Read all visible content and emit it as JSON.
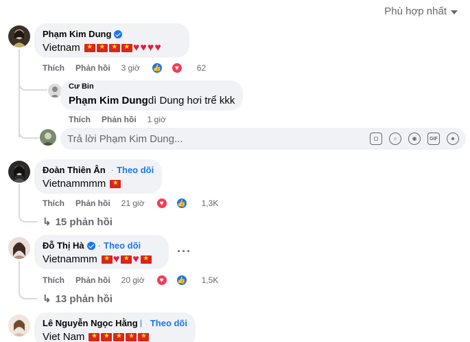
{
  "sort_label": "Phù hợp nhất",
  "comments": [
    {
      "name": "Phạm Kim Dung",
      "text": "Vietnam",
      "like": "Thích",
      "reply": "Phản hồi",
      "time": "3 giờ",
      "reaction_count": "62",
      "reply_preview": {
        "name": "Cư Bin",
        "tag": "Phạm Kim Dung",
        "text": "dì Dung hơi trể kkk",
        "like": "Thích",
        "reply": "Phản hồi",
        "time": "1 giờ"
      },
      "reply_input_placeholder": "Trả lời Phạm Kim Dung..."
    },
    {
      "name": "Đoàn Thiên Ân",
      "follow": "Theo dõi",
      "text": "Vietnammmm",
      "like": "Thích",
      "reply": "Phản hồi",
      "time": "21 giờ",
      "reaction_count": "1,3K",
      "replies_label": "15 phản hồi"
    },
    {
      "name": "Đỗ Thị Hà",
      "follow": "Theo dõi",
      "text": "Vietnammm",
      "like": "Thích",
      "reply": "Phản hồi",
      "time": "20 giờ",
      "reaction_count": "1,5K",
      "replies_label": "13 phản hồi"
    },
    {
      "name": "Lê Nguyễn Ngọc Hằng",
      "follow": "Theo dõi",
      "text": "Viet Nam"
    }
  ],
  "separator": "·",
  "colors": {
    "link": "#1877f2",
    "bubble": "#f0f2f5",
    "muted": "#65676b",
    "flag": "#da251d",
    "heart": "#e41e3f"
  }
}
